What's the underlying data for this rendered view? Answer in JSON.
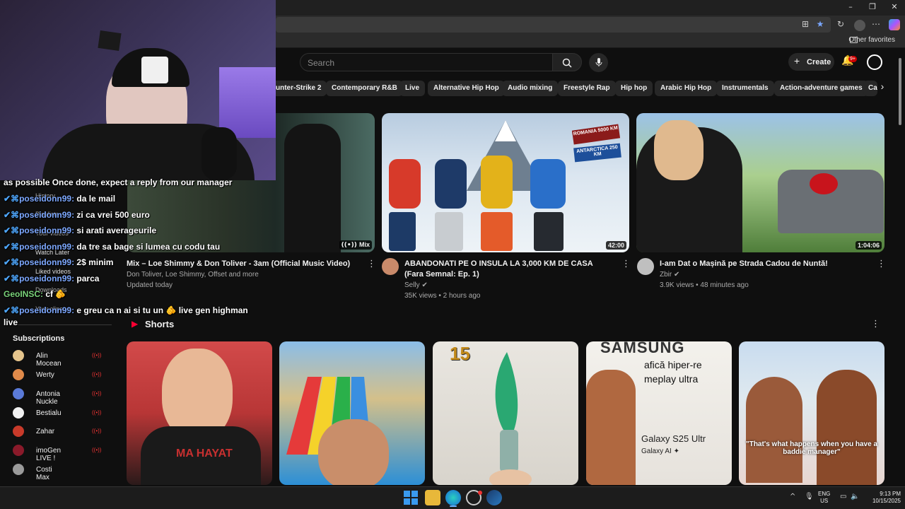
{
  "browser": {
    "window_controls": [
      "–",
      "❐",
      "✕"
    ],
    "favorites_other": "Other favorites"
  },
  "header": {
    "search_placeholder": "Search",
    "create_label": "Create",
    "notif_badge": "9+"
  },
  "chips": [
    "unter-Strike 2",
    "Contemporary R&B",
    "Live",
    "Alternative Hip Hop",
    "Audio mixing",
    "Freestyle Rap",
    "Hip hop",
    "Arabic Hip Hop",
    "Instrumentals",
    "Action-adventure games",
    "Ca"
  ],
  "videos": [
    {
      "title": "Mix – Loe Shimmy & Don Toliver - 3am (Official Music Video)",
      "channel": "Don Toliver, Loe Shimmy, Offset and more",
      "meta": "Updated today",
      "badge": "Mix"
    },
    {
      "title": "ABANDONATI PE O INSULA LA 3,000 KM DE CASA (Fara Semnal: Ep. 1)",
      "channel": "Selly ✔",
      "meta": "35K views • 2 hours ago",
      "badge": "42:00",
      "sign1": "ROMANIA 5000 KM",
      "sign2": "ANTARCTICA 250 KM"
    },
    {
      "title": "I-am Dat o Mașină pe Strada Cadou de Nuntă!",
      "channel": "Zbir ✔",
      "meta": "3.9K views • 48 minutes ago",
      "badge": "1:04:06"
    }
  ],
  "shorts": {
    "title": "Shorts",
    "items": [
      {
        "overlay": "MA HAYAT"
      },
      {
        "overlay": ""
      },
      {
        "overlay": "15"
      },
      {
        "overlay": "SAMSUNG",
        "sub1": "afică hiper-re",
        "sub2": "meplay ultra",
        "sub3": "Galaxy S25 Ultr",
        "sub4": "Galaxy AI ✦"
      },
      {
        "overlay": "\"That's what happens when you have a baddie manager\""
      }
    ]
  },
  "sidebar": {
    "ghost_items": [
      "History",
      "Playlists",
      "Your videos",
      "Watch Later",
      "Liked videos",
      "Downloads",
      "Your clips"
    ],
    "subscriptions_title": "Subscriptions",
    "subscriptions": [
      "Alin Mocean",
      "Werty",
      "Antonia Nuckle",
      "Bestialu",
      "Zahar",
      "imoGen LIVE !",
      "Costi Max"
    ]
  },
  "chat": [
    {
      "user": "",
      "text": "as possible Once done, expect a reply from our manager"
    },
    {
      "user": "poseidonn99:",
      "text": "da le mail"
    },
    {
      "user": "poseidonn99:",
      "text": "zi ca vrei 500 euro"
    },
    {
      "user": "poseidonn99:",
      "text": "si arati averageurile"
    },
    {
      "user": "poseidonn99:",
      "text": "da tre sa bage si lumea cu codu tau"
    },
    {
      "user": "poseidonn99:",
      "text": "2$ minim"
    },
    {
      "user": "poseidonn99:",
      "text": "parca"
    },
    {
      "user": "GeoINSC:",
      "text": "cf 🫵"
    },
    {
      "user": "poseidonn99:",
      "text": "e greu ca n ai si tu un 🫵 live gen highman"
    },
    {
      "user": "",
      "text": "live"
    }
  ],
  "taskbar": {
    "lang1": "ENG",
    "lang2": "US",
    "time": "9:13 PM",
    "date": "10/15/2025"
  },
  "colors": {
    "bg": "#0f0f0f",
    "chip": "#272727",
    "accent_red": "#ff0033"
  }
}
